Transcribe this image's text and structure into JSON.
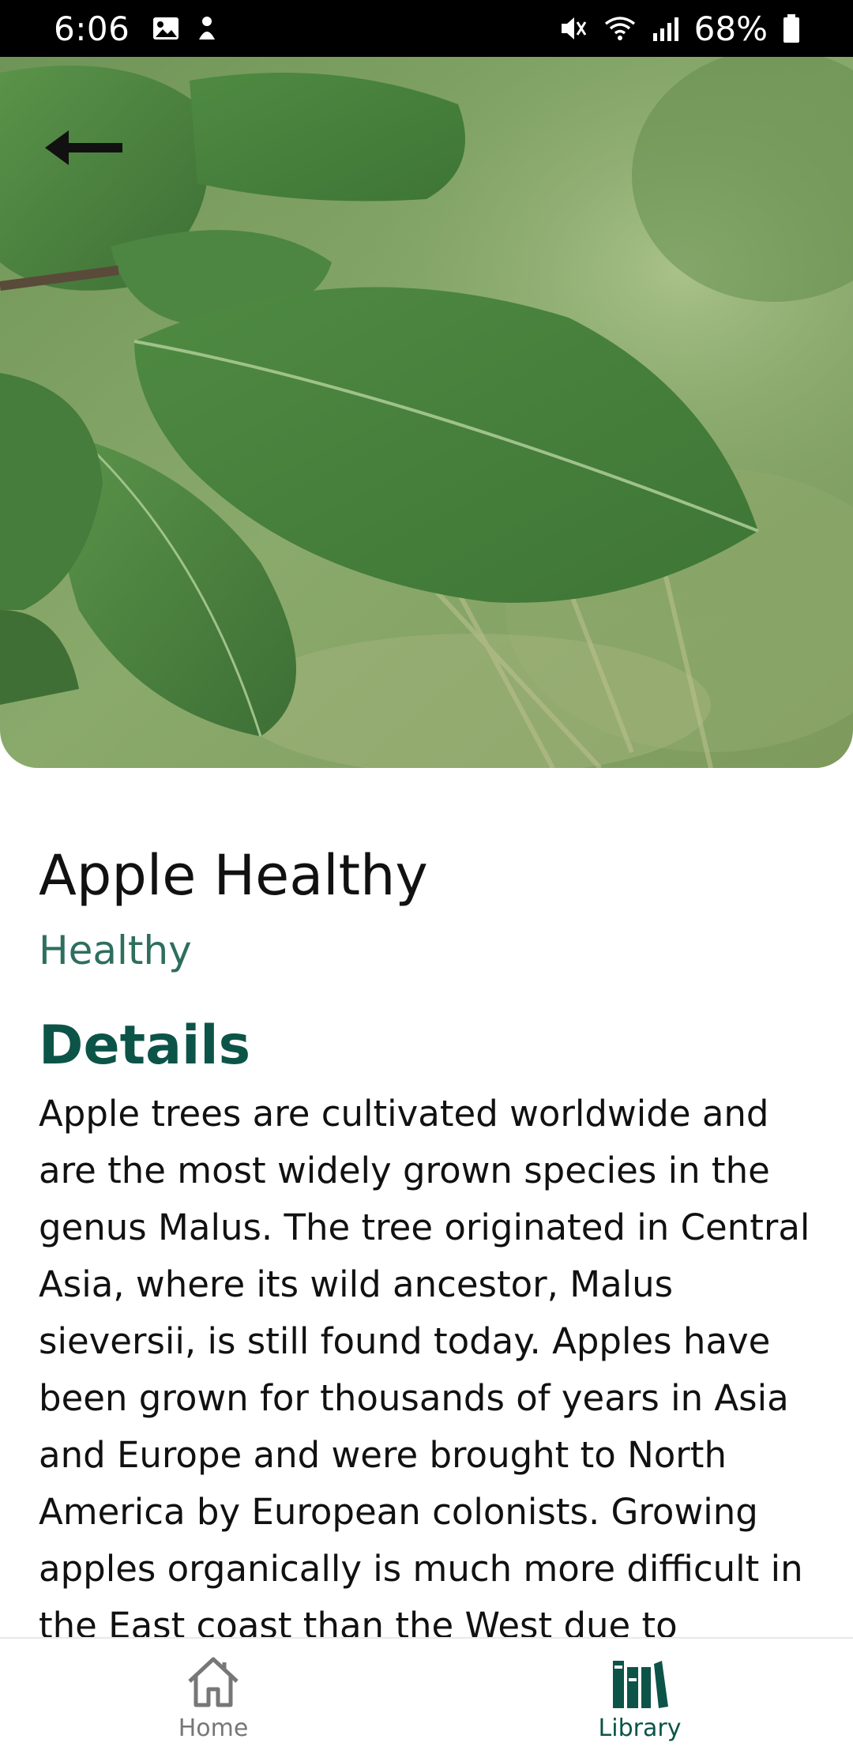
{
  "status_bar": {
    "time": "6:06",
    "battery": "68%",
    "left_icons": [
      "image-icon",
      "notification-icon"
    ],
    "right_icons": [
      "mute-icon",
      "wifi-icon",
      "signal-icon",
      "battery-icon"
    ]
  },
  "hero": {
    "image": "apple-leaf-photo",
    "back_icon": "arrow-left-icon"
  },
  "plant": {
    "title": "Apple Healthy",
    "status": "Healthy"
  },
  "details": {
    "heading": "Details",
    "body": "Apple trees are cultivated worldwide and are the most widely grown species in the genus Malus. The tree originated in Central Asia, where its wild ancestor, Malus sieversii, is still found today. Apples have been grown for thousands of years in Asia and Europe and were brought to North America by European colonists. Growing apples organically is much more difficult in the East coast than the West due to incidence of fungal diseases and types"
  },
  "nav": {
    "items": [
      {
        "label": "Home",
        "icon": "home-icon",
        "active": false
      },
      {
        "label": "Library",
        "icon": "library-icon",
        "active": true
      }
    ]
  },
  "colors": {
    "accent": "#0c5448",
    "status_green": "#2e6e5f",
    "inactive": "#777777"
  }
}
